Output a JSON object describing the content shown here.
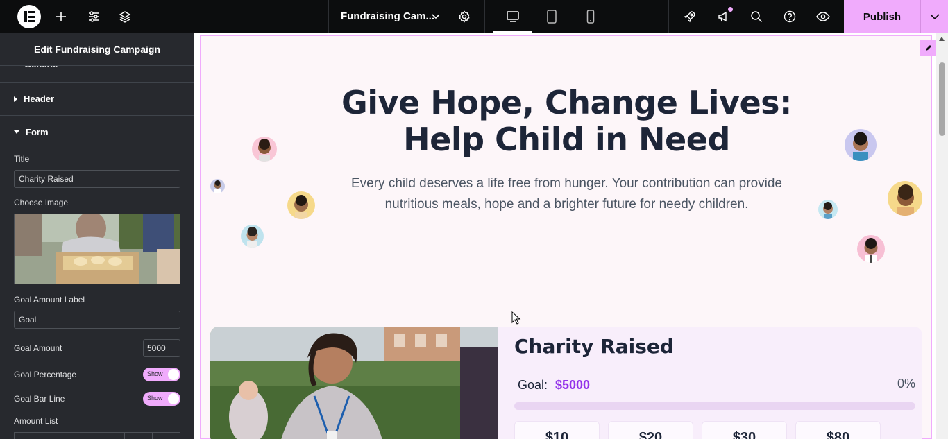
{
  "topbar": {
    "document_title": "Fundraising Cam...",
    "publish_label": "Publish",
    "icons": [
      "elementor-logo-icon",
      "add-icon",
      "settings-sliders-icon",
      "layers-icon",
      "chevron-down-icon",
      "gear-icon",
      "desktop-icon",
      "tablet-icon",
      "mobile-icon",
      "rocket-icon",
      "megaphone-icon",
      "search-icon",
      "help-icon",
      "eye-icon",
      "chevron-down-icon"
    ],
    "accent": "#f0abfc"
  },
  "panel": {
    "title": "Edit Fundraising Campaign",
    "cut_section": "General",
    "sections": [
      {
        "label": "Header",
        "expanded": false
      },
      {
        "label": "Form",
        "expanded": true
      }
    ],
    "fields": {
      "title_label": "Title",
      "title_value": "Charity Raised",
      "choose_image_label": "Choose Image",
      "goal_amount_label_label": "Goal Amount Label",
      "goal_amount_label_value": "Goal",
      "goal_amount_label": "Goal Amount",
      "goal_amount_value": "5000",
      "goal_percentage_label": "Goal Percentage",
      "goal_percentage_toggle": "Show",
      "goal_bar_line_label": "Goal Bar Line",
      "goal_bar_line_toggle": "Show",
      "amount_list_label": "Amount List"
    }
  },
  "canvas": {
    "hero_title": "Give Hope, Change Lives: Help Child in Need",
    "hero_subtitle": "Every child deserves a life free from hunger. Your contribution can provide nutritious meals, hope and a brighter future for needy children.",
    "card": {
      "title": "Charity Raised",
      "goal_label": "Goal:",
      "goal_value": "$5000",
      "goal_percent": "0%",
      "progress_fraction": 0,
      "amounts": [
        "$10",
        "$20",
        "$30",
        "$80"
      ]
    }
  }
}
